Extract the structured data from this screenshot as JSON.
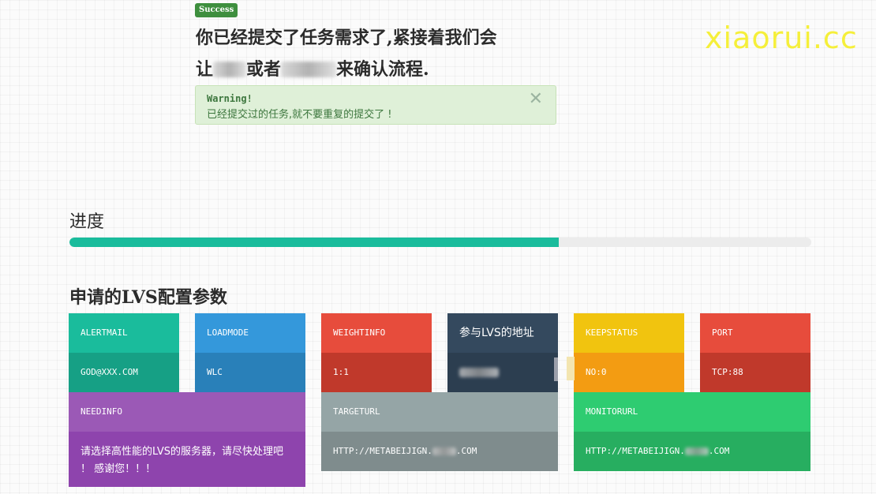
{
  "success_badge": "Success",
  "message": {
    "line1": "你已经提交了任务需求了,紧接着我们会",
    "line2_a": "让",
    "line2_b": "或者",
    "line2_c": "来确认流程."
  },
  "alert": {
    "title": "Warning!",
    "text": "已经提交过的任务,就不要重复的提交了 !",
    "close": "✕"
  },
  "watermark": "xiaorui.cc",
  "progress": {
    "label": "进度",
    "value_percent": 66
  },
  "section_title": "申请的LVS配置参数",
  "colors": {
    "turquoise": "#1abc9c",
    "turquoise_dark": "#16a085",
    "blue": "#3498db",
    "blue_dark": "#2980b9",
    "red": "#e74c3c",
    "red_dark": "#c0392b",
    "navy": "#34495e",
    "navy_dark": "#2c3e50",
    "yellow": "#f1c40f",
    "orange": "#f39c12",
    "purple": "#9b59b6",
    "purple_dark": "#8e44ad",
    "gray": "#95a5a6",
    "gray_dark": "#7f8c8d",
    "green": "#2ecc71",
    "green_dark": "#27ae60"
  },
  "params": {
    "alertmail": {
      "label": "ALERTMAIL",
      "value": "GOD@XXX.COM"
    },
    "loadmode": {
      "label": "LOADMODE",
      "value": "WLC"
    },
    "weightinfo": {
      "label": "WEIGHTINFO",
      "value": "1:1"
    },
    "address": {
      "label": "参与LVS的地址",
      "value": ""
    },
    "keepstatus": {
      "label": "KEEPSTATUS",
      "value": "NO:0"
    },
    "port": {
      "label": "PORT",
      "value": "TCP:88"
    },
    "needinfo": {
      "label": "NEEDINFO",
      "value": "请选择高性能的LVS的服务器，请尽快处理吧 ！ 感谢您！！！"
    },
    "targeturl": {
      "label": "TARGETURL",
      "value_a": "HTTP://METABEIJIGN.",
      "value_b": ".COM"
    },
    "monitorurl": {
      "label": "MONITORURL",
      "value_a": "HTTP://METABEIJIGN.",
      "value_b": ".COM"
    }
  }
}
